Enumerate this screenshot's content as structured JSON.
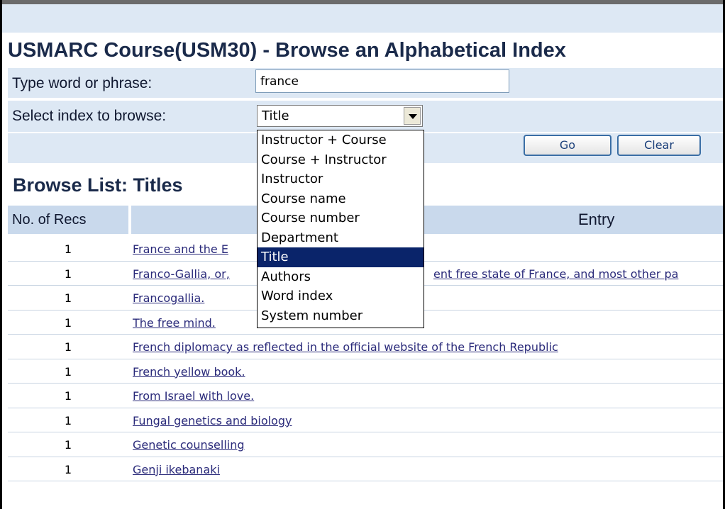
{
  "page_title": "USMARC Course(USM30) - Browse an Alphabetical Index",
  "form": {
    "word_label": "Type word or phrase:",
    "word_value": "france",
    "index_label": "Select index to browse:",
    "index_selected": "Title",
    "index_options": [
      "Instructor + Course",
      "Course + Instructor",
      "Instructor",
      "Course name",
      "Course number",
      "Department",
      "Title",
      "Authors",
      "Word index",
      "System number"
    ],
    "go_label": "Go",
    "clear_label": "Clear"
  },
  "browse": {
    "heading": "Browse List: Titles",
    "col_recs": "No. of Recs",
    "col_entry": "Entry",
    "rows": [
      {
        "count": "1",
        "entry": "France and the E"
      },
      {
        "count": "1",
        "entry": "Franco-Gallia, or,"
      },
      {
        "count": "1",
        "entry": "Francogallia."
      },
      {
        "count": "1",
        "entry": "The free mind."
      },
      {
        "count": "1",
        "entry": "French diplomacy as reflected in the official website of the French Republic"
      },
      {
        "count": "1",
        "entry": "French yellow book."
      },
      {
        "count": "1",
        "entry": "From Israel with love."
      },
      {
        "count": "1",
        "entry": "Fungal genetics and biology"
      },
      {
        "count": "1",
        "entry": "Genetic counselling"
      },
      {
        "count": "1",
        "entry": "Genji ikebanaki"
      }
    ],
    "row2_tail": "ent free state of France, and most other pa"
  },
  "colors": {
    "band": "#dde8f4",
    "header": "#c9d9ec",
    "highlight": "#0a246a",
    "link": "#2a2a7a"
  }
}
